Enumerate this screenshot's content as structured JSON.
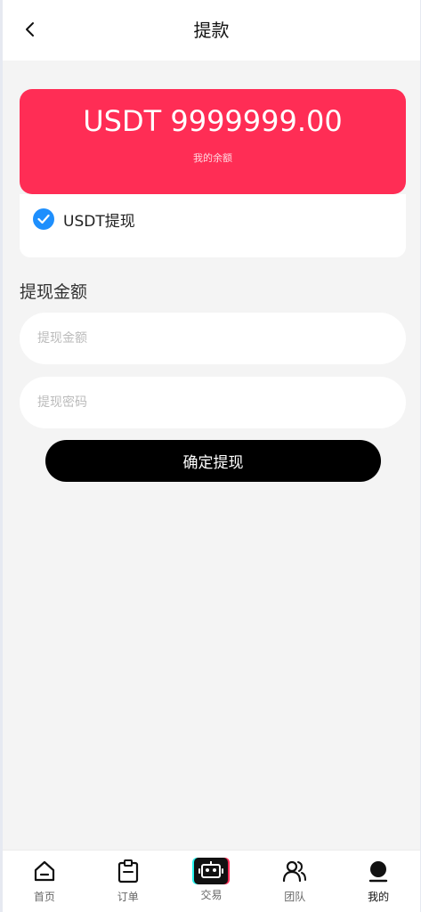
{
  "header": {
    "title": "提款",
    "back_icon": "chevron-left-icon"
  },
  "balance": {
    "amount": "USDT 9999999.00",
    "label": "我的余额",
    "card_color": "#ff2d55"
  },
  "withdraw_method": {
    "label": "USDT提现",
    "selected": true,
    "check_color": "#1e8ffd"
  },
  "form": {
    "section_label": "提现金额",
    "amount_placeholder": "提现金额",
    "password_placeholder": "提现密码",
    "submit_label": "确定提现"
  },
  "tabbar": {
    "items": [
      {
        "label": "首页",
        "icon": "home-icon"
      },
      {
        "label": "订单",
        "icon": "clipboard-icon"
      },
      {
        "label": "交易",
        "icon": "robot-icon"
      },
      {
        "label": "团队",
        "icon": "team-icon"
      },
      {
        "label": "我的",
        "icon": "profile-icon",
        "active": true
      }
    ]
  }
}
